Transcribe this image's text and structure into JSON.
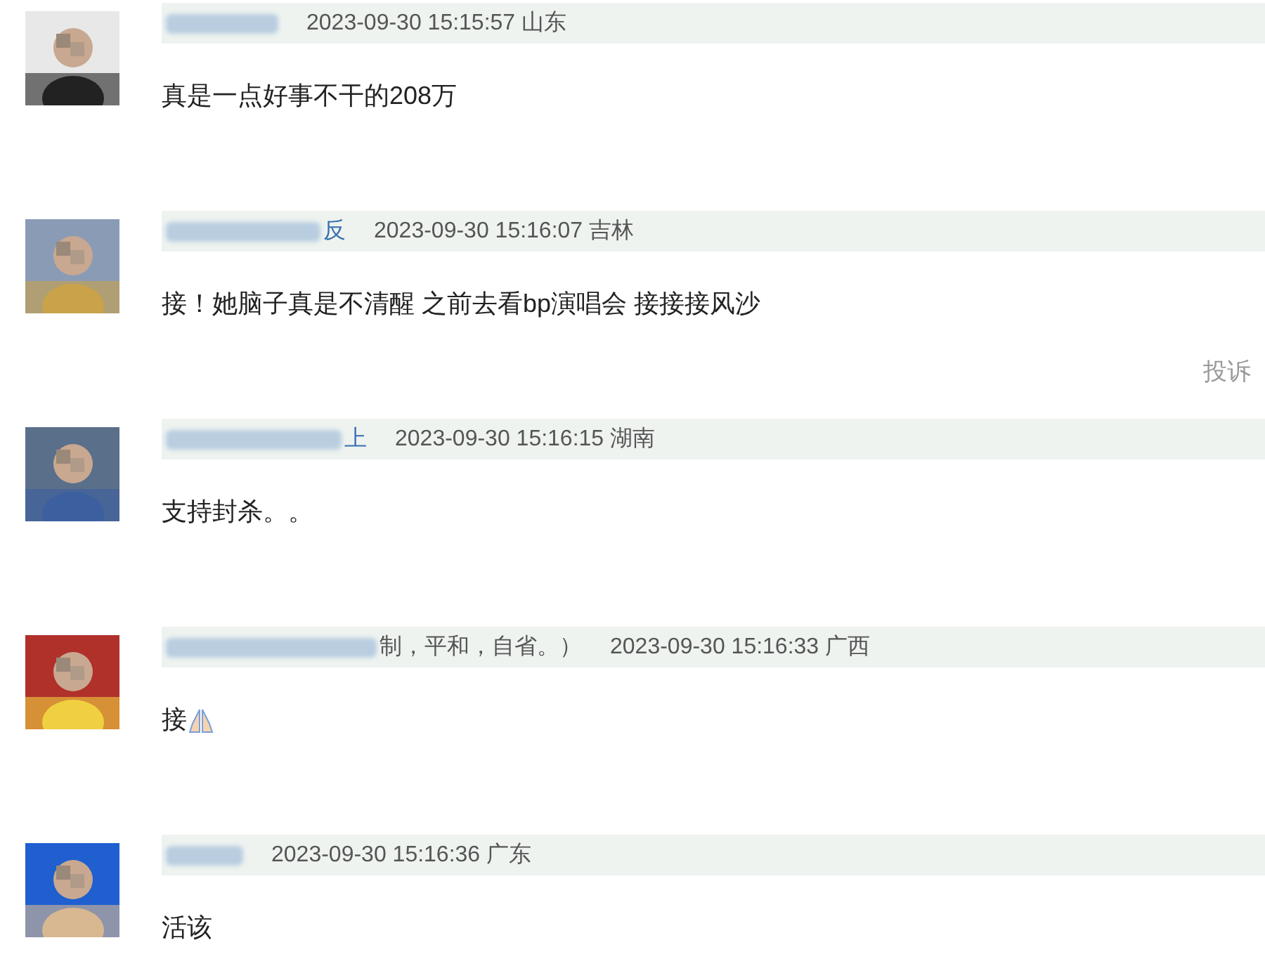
{
  "comments": [
    {
      "kind": "text",
      "time": "2023-09-30 15:15:57",
      "region": "山东",
      "text": "真是一点好事不干的208万"
    },
    {
      "kind": "text",
      "name_visible": "反",
      "time": "2023-09-30 15:16:07",
      "region": "吉林",
      "text": "接！她脑子真是不清醒 之前去看bp演唱会 接接接风沙",
      "report": "投诉"
    },
    {
      "kind": "text",
      "name_visible": "上",
      "time": "2023-09-30 15:16:15",
      "region": "湖南",
      "text": "支持封杀。。"
    },
    {
      "kind": "text_with_emoji",
      "name_suffix": "制，平和，自省。）",
      "time": "2023-09-30 15:16:33",
      "region": "广西",
      "text": "接"
    },
    {
      "kind": "text",
      "time": "2023-09-30 15:16:36",
      "region": "广东",
      "text": "活该"
    }
  ]
}
